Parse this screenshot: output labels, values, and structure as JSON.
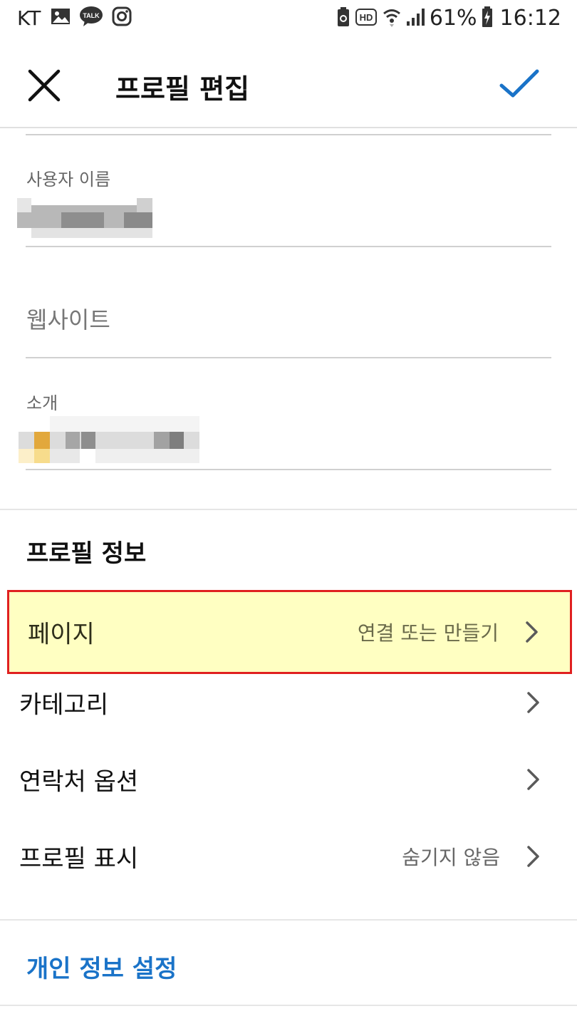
{
  "status_bar": {
    "carrier": "KT",
    "battery_percent": "61%",
    "time": "16:12",
    "left_icons": [
      "gallery-icon",
      "kakaotalk-icon",
      "instagram-icon"
    ],
    "right_icons": [
      "battery-saver-icon",
      "hd-voice-icon",
      "wifi-icon",
      "signal-icon",
      "battery-charging-icon"
    ],
    "kakaotalk_text": "TALK",
    "hd_text": "HD"
  },
  "header": {
    "title": "프로필 편집",
    "close_icon": "close-icon",
    "done_icon": "check-icon",
    "accent_color": "#1a73c8"
  },
  "fields": {
    "username": {
      "label": "사용자 이름"
    },
    "website": {
      "placeholder": "웹사이트"
    },
    "bio": {
      "label": "소개"
    }
  },
  "profile_info": {
    "title": "프로필 정보",
    "rows": [
      {
        "label": "페이지",
        "value": "연결 또는 만들기",
        "highlighted": true
      },
      {
        "label": "카테고리",
        "value": ""
      },
      {
        "label": "연락처 옵션",
        "value": ""
      },
      {
        "label": "프로필 표시",
        "value": "숨기지 않음"
      }
    ]
  },
  "privacy": {
    "label": "개인 정보 설정"
  },
  "colors": {
    "highlight_fill": "#ffffc2",
    "highlight_border": "#e02020",
    "link": "#1a73c8"
  }
}
